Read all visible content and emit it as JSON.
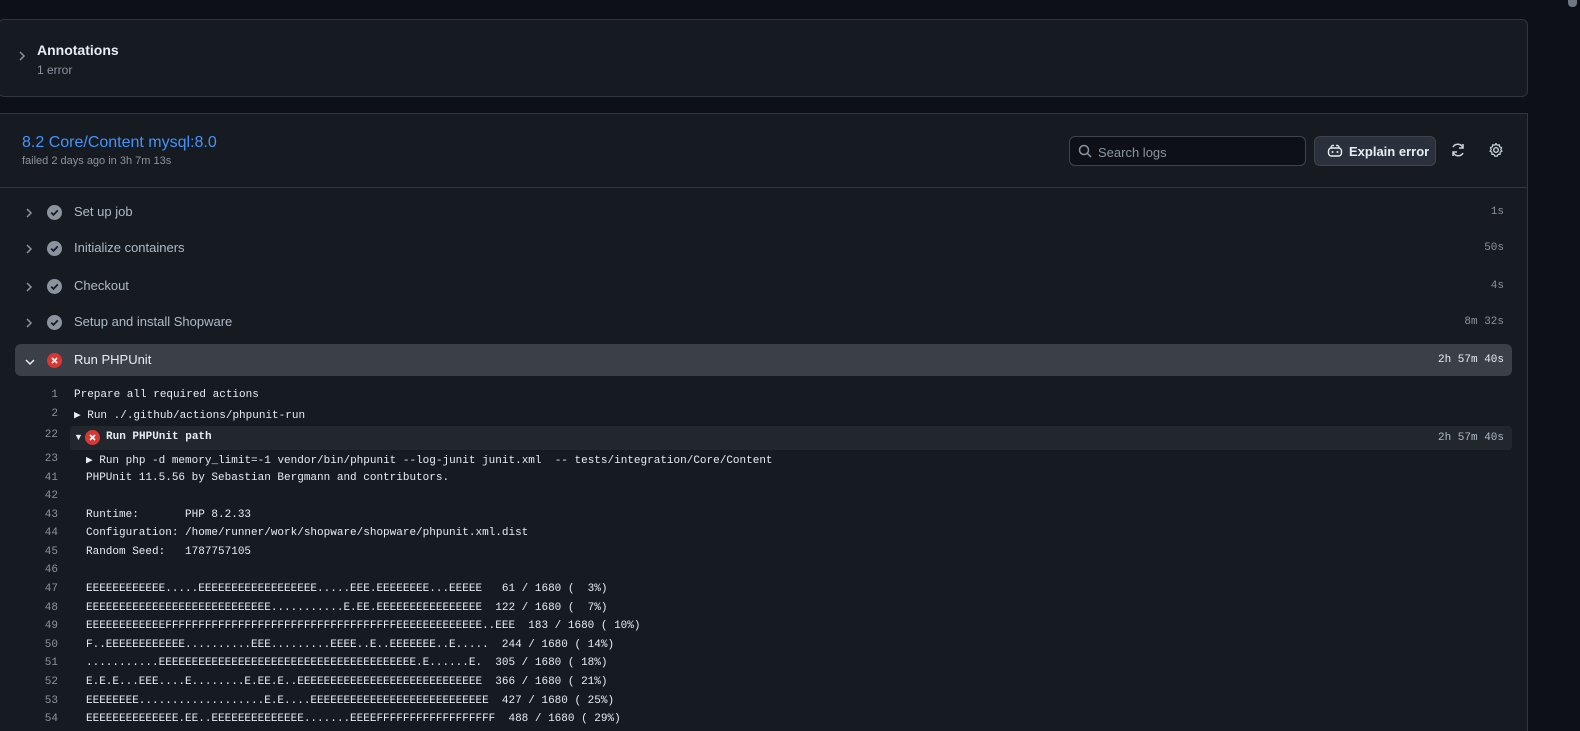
{
  "annotations": {
    "title": "Annotations",
    "subtitle": "1 error"
  },
  "job": {
    "title": "8.2 Core/Content mysql:8.0",
    "subtitle": "failed 2 days ago in 3h 7m 13s",
    "search_placeholder": "Search logs",
    "explain_label": "Explain error"
  },
  "steps": [
    {
      "name": "Set up job",
      "duration": "1s",
      "status": "success"
    },
    {
      "name": "Initialize containers",
      "duration": "50s",
      "status": "success"
    },
    {
      "name": "Checkout",
      "duration": "4s",
      "status": "success"
    },
    {
      "name": "Setup and install Shopware",
      "duration": "8m 32s",
      "status": "success"
    },
    {
      "name": "Run PHPUnit",
      "duration": "2h 57m 40s",
      "status": "failure"
    }
  ],
  "log_head": [
    {
      "num": "1",
      "text": "Prepare all required actions"
    },
    {
      "num": "2",
      "text": "▶ Run ./.github/actions/phpunit-run"
    }
  ],
  "group": {
    "num": "22",
    "arrow": "▼",
    "name": "Run PHPUnit path",
    "duration": "2h 57m 40s"
  },
  "log_body": [
    {
      "num": "23",
      "text": "▶ Run php -d memory_limit=-1 vendor/bin/phpunit --log-junit junit.xml  -- tests/integration/Core/Content"
    },
    {
      "num": "41",
      "text": "PHPUnit 11.5.56 by Sebastian Bergmann and contributors."
    },
    {
      "num": "42",
      "text": ""
    },
    {
      "num": "43",
      "text": "Runtime:       PHP 8.2.33"
    },
    {
      "num": "44",
      "text": "Configuration: /home/runner/work/shopware/shopware/phpunit.xml.dist"
    },
    {
      "num": "45",
      "text": "Random Seed:   1787757105"
    },
    {
      "num": "46",
      "text": ""
    },
    {
      "num": "47",
      "text": "EEEEEEEEEEEE.....EEEEEEEEEEEEEEEEEE.....EEE.EEEEEEEE...EEEEE   61 / 1680 (  3%)"
    },
    {
      "num": "48",
      "text": "EEEEEEEEEEEEEEEEEEEEEEEEEEEE...........E.EE.EEEEEEEEEEEEEEEE  122 / 1680 (  7%)"
    },
    {
      "num": "49",
      "text": "EEEEEEEEEEEEFFFFFFFFFFFFFFFFFFFFFFFFFFFFFFFFFFFEEEEEEEEEEEEE..EEE  183 / 1680 ( 10%)"
    },
    {
      "num": "50",
      "text": "F..EEEEEEEEEEEE..........EEE.........EEEE..E..EEEEEEE..E.....  244 / 1680 ( 14%)"
    },
    {
      "num": "51",
      "text": "...........EEEEEEEEEEEEEEEEEEEEEEEEEEEEEEEEEEEEEEE.E......E.  305 / 1680 ( 18%)"
    },
    {
      "num": "52",
      "text": "E.E.E...EEE....E........E.EE.E..EEEEEEEEEEEEEEEEEEEEEEEEEEEE  366 / 1680 ( 21%)"
    },
    {
      "num": "53",
      "text": "EEEEEEEE...................E.E....EEEEEEEEEEEEEEEEEEEEEEEEEEE  427 / 1680 ( 25%)"
    },
    {
      "num": "54",
      "text": "EEEEEEEEEEEEEE.EE..EEEEEEEEEEEEEE.......EEEEFFFFFFFFFFFFFFFFFF  488 / 1680 ( 29%)"
    }
  ],
  "colors": {
    "success": "#8b949e",
    "failure": "#da3633",
    "link": "#4493f8"
  }
}
